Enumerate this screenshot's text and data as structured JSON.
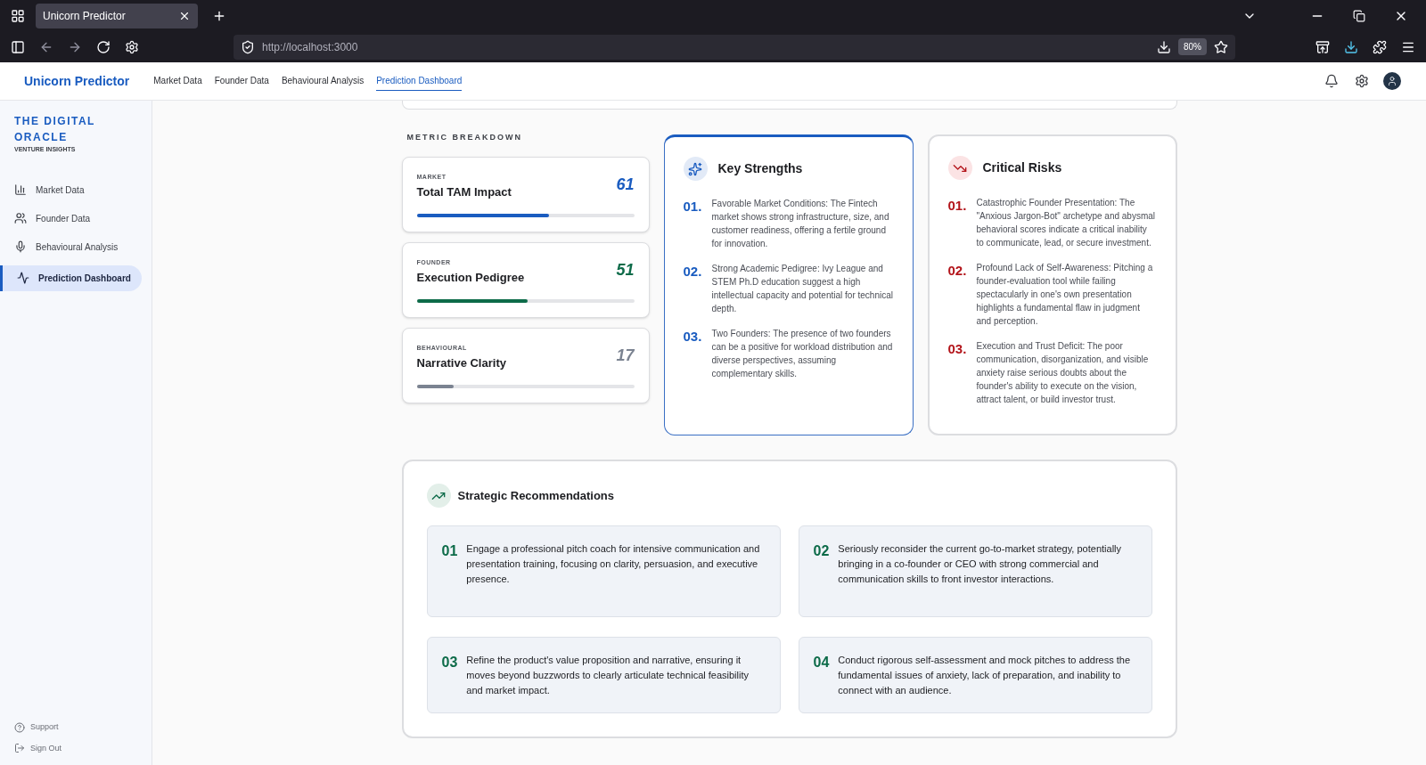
{
  "browser": {
    "tab_title": "Unicorn Predictor",
    "url_host": "http://localhost",
    "url_port": ":3000",
    "zoom": "80%"
  },
  "header": {
    "brand": "Unicorn Predictor",
    "nav": [
      {
        "label": "Market Data",
        "selected": false
      },
      {
        "label": "Founder Data",
        "selected": false
      },
      {
        "label": "Behavioural Analysis",
        "selected": false
      },
      {
        "label": "Prediction Dashboard",
        "selected": true
      }
    ]
  },
  "sidebar": {
    "title": "THE DIGITAL ORACLE",
    "subtitle": "VENTURE INSIGHTS",
    "items": [
      {
        "label": "Market Data",
        "kind": "chart",
        "selected": false
      },
      {
        "label": "Founder Data",
        "kind": "people",
        "selected": false
      },
      {
        "label": "Behavioural Analysis",
        "kind": "mic",
        "selected": false
      },
      {
        "label": "Prediction Dashboard",
        "kind": "pulse",
        "selected": true
      }
    ],
    "footer": [
      {
        "label": "Support",
        "kind": "help"
      },
      {
        "label": "Sign Out",
        "kind": "signout"
      }
    ]
  },
  "metric_breakdown": {
    "heading": "METRIC BREAKDOWN",
    "metrics": [
      {
        "category": "MARKET",
        "title": "Total TAM Impact",
        "score": "61",
        "level": 0.61,
        "color": "#1a5cc0"
      },
      {
        "category": "FOUNDER",
        "title": "Execution Pedigree",
        "score": "51",
        "level": 0.51,
        "color": "#0d6b49"
      },
      {
        "category": "BEHAVIOURAL",
        "title": "Narrative Clarity",
        "score": "17",
        "level": 0.17,
        "color": "#7b8391"
      }
    ]
  },
  "key_strengths": {
    "title": "Key Strengths",
    "items": [
      {
        "number": "01.",
        "text": "Favorable Market Conditions: The Fintech market shows strong infrastructure, size, and customer readiness, offering a fertile ground for innovation."
      },
      {
        "number": "02.",
        "text": "Strong Academic Pedigree: Ivy League and STEM Ph.D education suggest a high intellectual capacity and potential for technical depth."
      },
      {
        "number": "03.",
        "text": "Two Founders: The presence of two founders can be a positive for workload distribution and diverse perspectives, assuming complementary skills."
      }
    ]
  },
  "critical_risks": {
    "title": "Critical Risks",
    "items": [
      {
        "number": "01.",
        "text": "Catastrophic Founder Presentation: The \"Anxious Jargon-Bot\" archetype and abysmal behavioral scores indicate a critical inability to communicate, lead, or secure investment."
      },
      {
        "number": "02.",
        "text": "Profound Lack of Self-Awareness: Pitching a founder-evaluation tool while failing spectacularly in one's own presentation highlights a fundamental flaw in judgment and perception."
      },
      {
        "number": "03.",
        "text": "Execution and Trust Deficit: The poor communication, disorganization, and visible anxiety raise serious doubts about the founder's ability to execute on the vision, attract talent, or build investor trust."
      }
    ]
  },
  "recommendations": {
    "title": "Strategic Recommendations",
    "items": [
      {
        "number": "01",
        "text": "Engage a professional pitch coach for intensive communication and presentation training, focusing on clarity, persuasion, and executive presence."
      },
      {
        "number": "02",
        "text": "Seriously reconsider the current go-to-market strategy, potentially bringing in a co-founder or CEO with strong commercial and communication skills to front investor interactions."
      },
      {
        "number": "03",
        "text": "Refine the product's value proposition and narrative, ensuring it moves beyond buzzwords to clearly articulate technical feasibility and market impact."
      },
      {
        "number": "04",
        "text": "Conduct rigorous self-assessment and mock pitches to address the fundamental issues of anxiety, lack of preparation, and inability to connect with an audience."
      }
    ]
  }
}
